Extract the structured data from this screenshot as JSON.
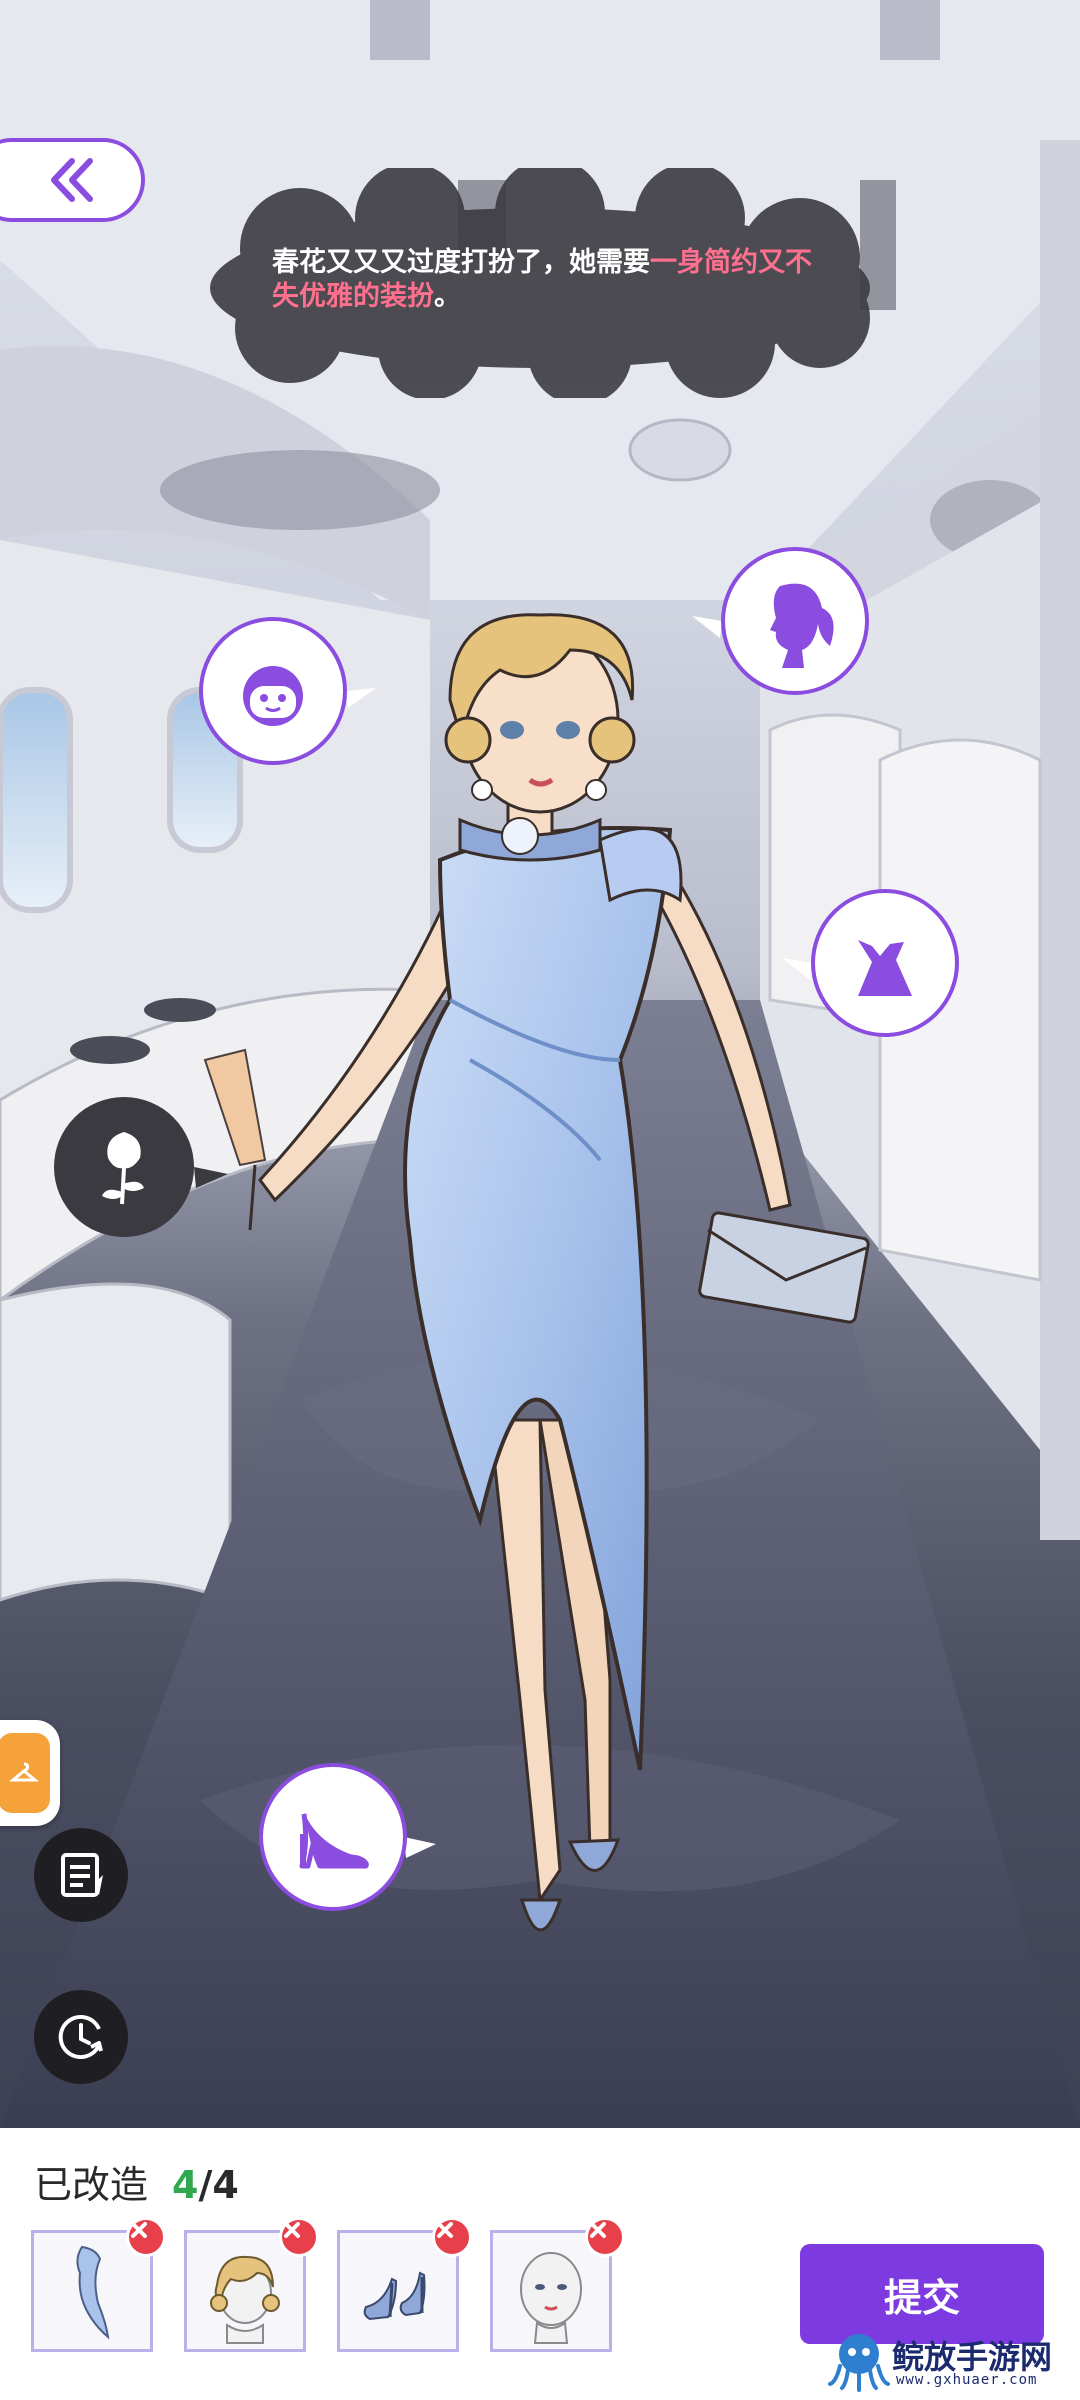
{
  "dialog": {
    "text_normal": "春花又又又过度打扮了，她需要",
    "text_highlight": "一身简约又不失优雅的装扮",
    "text_end": "。"
  },
  "categories": [
    {
      "id": "face",
      "icon": "face-icon"
    },
    {
      "id": "hair",
      "icon": "hair-silhouette-icon"
    },
    {
      "id": "dress",
      "icon": "dress-icon"
    },
    {
      "id": "accessory",
      "icon": "rose-icon"
    },
    {
      "id": "shoes",
      "icon": "high-heel-icon"
    }
  ],
  "bottom": {
    "progress_label": "已改造",
    "progress_done": "4",
    "progress_total": "/4",
    "submit_label": "提交",
    "slots": [
      {
        "id": "dress",
        "icon": "dress-thumbnail"
      },
      {
        "id": "hair",
        "icon": "hairstyle-thumbnail"
      },
      {
        "id": "shoes",
        "icon": "shoes-thumbnail"
      },
      {
        "id": "face",
        "icon": "face-thumbnail"
      }
    ]
  },
  "watermark": {
    "name": "鲩放手游网",
    "url": "www.gxhuaer.com"
  },
  "colors": {
    "accent": "#7c3ae0",
    "bubble_border": "#8a4de0",
    "highlight_text": "#ff6f8e",
    "progress_done": "#2fa84f",
    "remove_badge": "#e8404a"
  }
}
